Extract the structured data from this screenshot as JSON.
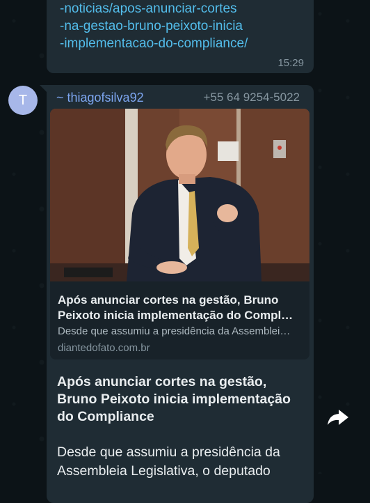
{
  "message_1": {
    "link_lines": [
      "-noticias/apos-anunciar-cortes",
      "-na-gestao-bruno-peixoto-inicia",
      "-implementacao-do-compliance/"
    ],
    "time": "15:29"
  },
  "message_2": {
    "avatar_letter": "T",
    "sender": "~ thiagofsilva92",
    "phone": "+55 64 9254-5022",
    "link_preview": {
      "title": "Após anunciar cortes na gestão, Bruno Peixoto inicia implementação do Compl…",
      "description": "Desde que assumiu a presidência da Assemblei…",
      "domain": "diantedofato.com.br"
    },
    "article_title": "Após anunciar cortes na gestão, Bruno Peixoto inicia implementação do Compliance",
    "article_body": "Desde que assumiu a presidência da Assembleia Legislativa, o deputado"
  },
  "colors": {
    "background": "#0c1317",
    "bubble": "#1f2c34",
    "link": "#53bdeb",
    "sender": "#7da6f0",
    "avatar": "#a7b7e9"
  },
  "icons": {
    "share": "share-forward-icon"
  }
}
